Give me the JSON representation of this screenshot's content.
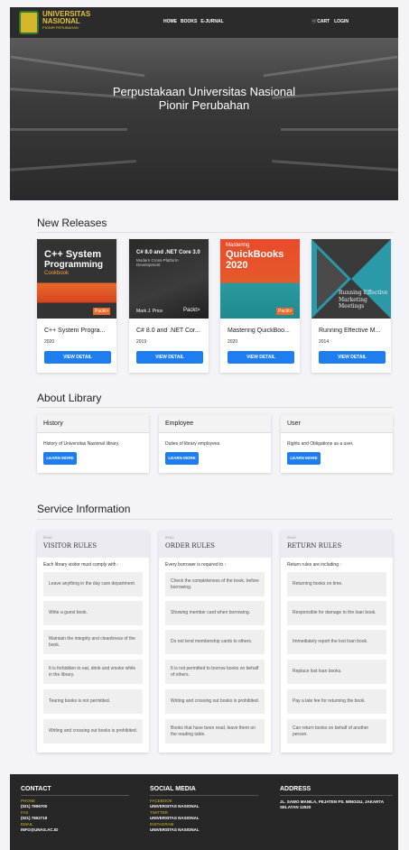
{
  "nav": {
    "logo_line1": "UNIVERSITAS",
    "logo_line2": "NASIONAL",
    "logo_sub": "PIONIR PERUBAHAN",
    "home": "HOME",
    "books": "BOOKS",
    "ejurnal": "E-JURNAL",
    "cart": "CART",
    "login": "LOGIN",
    "cart_icon": "cart-icon"
  },
  "hero": {
    "line1": "Perpustakaan Universitas Nasional",
    "line2": "Pionir Perubahan"
  },
  "new_releases": {
    "title": "New Releases",
    "books": [
      {
        "title": "C++ System Progra...",
        "year": "2020",
        "button": "VIEW DETAIL",
        "cover_top": "C++ System",
        "cover_mid": "Programming",
        "cover_sub": "Cookbook",
        "cover_badge": "Packt>"
      },
      {
        "title": "C# 8.0 and .NET Cor...",
        "year": "2019",
        "button": "VIEW DETAIL",
        "cover_top": "C# 8.0 and .NET Core 3.0",
        "cover_mid": "Modern Cross-Platform Development",
        "cover_sub": "Mark J. Price",
        "cover_badge": "Packt>"
      },
      {
        "title": "Mastering QuickBoo...",
        "year": "2020",
        "button": "VIEW DETAIL",
        "cover_top": "Mastering",
        "cover_mid": "QuickBooks",
        "cover_sub": "2020",
        "cover_badge": "Packt>"
      },
      {
        "title": "Running Effective M...",
        "year": "2014",
        "button": "VIEW DETAIL",
        "cover_top": "Running Effective",
        "cover_mid": "Marketing Meetings",
        "cover_sub": "",
        "cover_badge": ""
      }
    ]
  },
  "about": {
    "title": "About Library",
    "cards": [
      {
        "heading": "History",
        "text": "History of Universitas Nasional library.",
        "button": "LEARN MORE"
      },
      {
        "heading": "Employee",
        "text": "Duties of library employees.",
        "button": "LEARN MORE"
      },
      {
        "heading": "User",
        "text": "Rights and Obligations as a user.",
        "button": "LEARN MORE"
      }
    ]
  },
  "service": {
    "title": "Service Information",
    "cards": [
      {
        "read": "READ",
        "name": "VISITOR RULES",
        "intro": "Each library visitor must comply with :",
        "rules": [
          "Leave anything in the day care department.",
          "Write a guest book.",
          "Maintain the integrity and cleanliness of the book.",
          "It is forbidden to eat, drink and smoke while in the library.",
          "Tearing books is not permitted.",
          "Writing and crossing out books is prohibited."
        ]
      },
      {
        "read": "READ",
        "name": "ORDER RULES",
        "intro": "Every borrower is required to :",
        "rules": [
          "Check the completeness of the book, before borrowing.",
          "Showing member card when borrowing.",
          "Do not lend membership cards to others.",
          "It is not permitted to borrow books on behalf of others.",
          "Writing and crossing out books is prohibited.",
          "Books that have been read, leave them on the reading table."
        ]
      },
      {
        "read": "READ",
        "name": "RETURN RULES",
        "intro": "Return rules are including :",
        "rules": [
          "Returning books on time.",
          "Responsible for damage to the loan book.",
          "Immediately report the lost loan book.",
          "Replace lost loan books.",
          "Pay a late fee for returning the book.",
          "Can return books on behalf of another person."
        ]
      }
    ]
  },
  "footer": {
    "contact_title": "CONTACT",
    "phone_label": "PHONE",
    "phone": "(021) 7806700",
    "fax_label": "FAX",
    "fax": "(021) 7802718",
    "email_label": "EMAIL",
    "email": "INFO@UNAS.AC.ID",
    "social_title": "SOCIAL MEDIA",
    "facebook_label": "FACEBOOK",
    "facebook": "UNIVERSITAS NASIONAL",
    "twitter_label": "TWITTER",
    "twitter": "UNIVERSITAS NASIONAL",
    "instagram_label": "INSTAGRAM",
    "instagram": "UNIVERSITAS NASIONAL",
    "address_title": "ADDRESS",
    "address": "JL. SAWO MANILA, PEJATEN PS. MINGGU, JAKARTA SELATAN 12520"
  },
  "colors": {
    "accent": "#1e7ef0",
    "gold": "#d4b62a",
    "dark": "#2b2b2b"
  }
}
